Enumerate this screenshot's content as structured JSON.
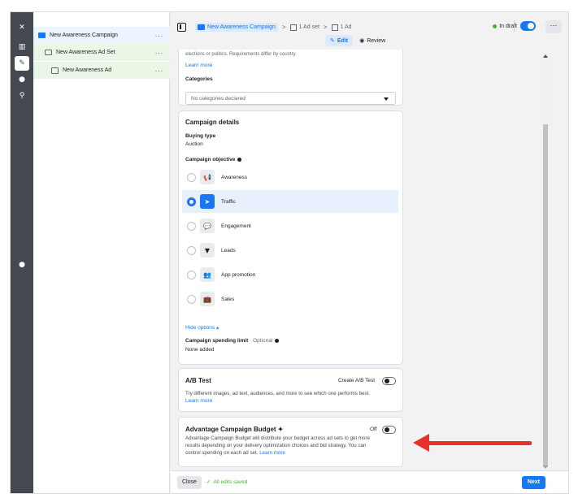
{
  "rail": {
    "icons": [
      "close-icon",
      "chart-icon",
      "pencil-icon",
      "clock-icon",
      "search-icon",
      "info-icon"
    ]
  },
  "tree": {
    "campaign": "New Awareness Campaign",
    "adset": "New Awareness Ad Set",
    "ad": "New Awareness Ad",
    "more": "···"
  },
  "header": {
    "crumb_campaign": "New Awareness Campaign",
    "crumb_adset": "1 Ad set",
    "crumb_ad": "1 Ad",
    "separator": ">",
    "edit": "Edit",
    "review": "Review",
    "status": "In draft",
    "more": "···"
  },
  "categories_card": {
    "cut_text": "elections or politics. Requirements differ by country.",
    "learn_more": "Learn more",
    "label": "Categories",
    "select_value": "No categories declared"
  },
  "campaign_details": {
    "title": "Campaign details",
    "buying_type_label": "Buying type",
    "buying_type_value": "Auction",
    "objective_label": "Campaign objective",
    "objectives": [
      {
        "label": "Awareness",
        "icon": "megaphone-icon",
        "glyph": "📢"
      },
      {
        "label": "Traffic",
        "icon": "cursor-icon",
        "glyph": "➤"
      },
      {
        "label": "Engagement",
        "icon": "chat-bubbles-icon",
        "glyph": "💬"
      },
      {
        "label": "Leads",
        "icon": "funnel-icon",
        "glyph": "▼"
      },
      {
        "label": "App promotion",
        "icon": "people-icon",
        "glyph": "👥"
      },
      {
        "label": "Sales",
        "icon": "briefcase-icon",
        "glyph": "💼"
      }
    ],
    "selected_objective": "Traffic",
    "hide_options": "Hide options ▴",
    "spending_limit_label": "Campaign spending limit",
    "spending_limit_optional": " · Optional",
    "spending_limit_value": "None added"
  },
  "ab_test": {
    "title": "A/B Test",
    "toggle_label": "Create A/B Test",
    "desc": "Try different images, ad text, audiences, and more to see which one performs best.",
    "learn_more": "Learn more"
  },
  "advantage": {
    "title": "Advantage Campaign Budget ✦",
    "toggle_state": "Off",
    "desc": "Advantage Campaign Budget will distribute your budget across ad sets to get more results depending on your delivery optimization choices and bid strategy. You can control spending on each ad set.",
    "learn_more": "Learn more"
  },
  "footer": {
    "close": "Close",
    "saved": "All edits saved",
    "next": "Next"
  },
  "colors": {
    "accent": "#1877f2",
    "arrow": "#e8302b",
    "saved_green": "#42b72a"
  }
}
